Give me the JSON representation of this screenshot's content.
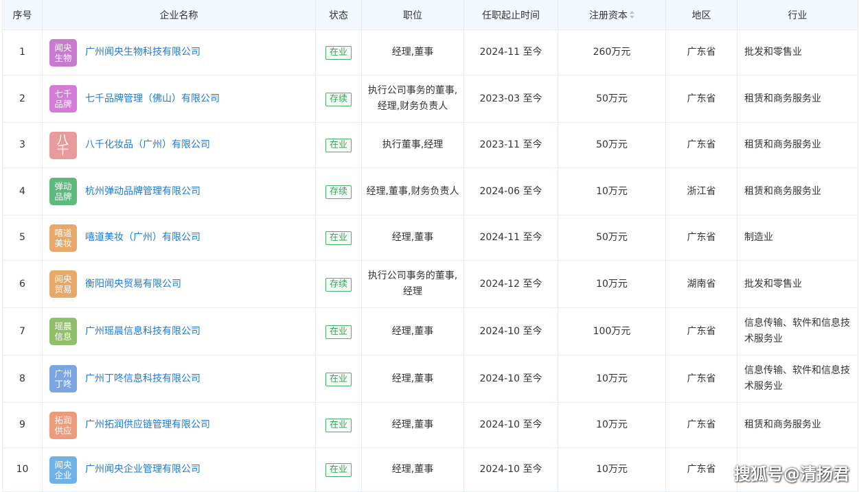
{
  "headers": {
    "index": "序号",
    "name": "企业名称",
    "status": "状态",
    "position": "职位",
    "term": "任职起止时间",
    "capital": "注册资本",
    "region": "地区",
    "industry": "行业"
  },
  "rows": [
    {
      "index": "1",
      "logo": "闻央生物",
      "logo_color": "#c77ad0",
      "name": "广州闻央生物科技有限公司",
      "status": "在业",
      "position": "经理,董事",
      "term": "2024-11 至今",
      "capital": "260万元",
      "region": "广东省",
      "industry": "批发和零售业"
    },
    {
      "index": "2",
      "logo": "七千品牌",
      "logo_color": "#d47bd6",
      "name": "七千品牌管理（佛山）有限公司",
      "status": "存续",
      "position": "执行公司事务的董事,经理,财务负责人",
      "term": "2023-03 至今",
      "capital": "50万元",
      "region": "广东省",
      "industry": "租赁和商务服务业"
    },
    {
      "index": "3",
      "logo": "八千",
      "logo_color": "#e79b9b",
      "name": "八千化妆品（广州）有限公司",
      "status": "在业",
      "position": "执行董事,经理",
      "term": "2023-11 至今",
      "capital": "50万元",
      "region": "广东省",
      "industry": "租赁和商务服务业"
    },
    {
      "index": "4",
      "logo": "弹动品牌",
      "logo_color": "#5dba7c",
      "name": "杭州弹动品牌管理有限公司",
      "status": "存续",
      "position": "经理,董事,财务负责人",
      "term": "2024-06 至今",
      "capital": "10万元",
      "region": "浙江省",
      "industry": "租赁和商务服务业"
    },
    {
      "index": "5",
      "logo": "嘻道美妆",
      "logo_color": "#e8a86a",
      "name": "嘻道美妆（广州）有限公司",
      "status": "在业",
      "position": "经理,董事",
      "term": "2024-11 至今",
      "capital": "50万元",
      "region": "广东省",
      "industry": "制造业"
    },
    {
      "index": "6",
      "logo": "闻央贸易",
      "logo_color": "#e8a86a",
      "name": "衡阳闻央贸易有限公司",
      "status": "存续",
      "position": "执行公司事务的董事,经理",
      "term": "2024-12 至今",
      "capital": "10万元",
      "region": "湖南省",
      "industry": "批发和零售业"
    },
    {
      "index": "7",
      "logo": "瑶晨信息",
      "logo_color": "#8fbf6b",
      "name": "广州瑶晨信息科技有限公司",
      "status": "在业",
      "position": "经理,董事",
      "term": "2024-10 至今",
      "capital": "100万元",
      "region": "广东省",
      "industry": "信息传输、软件和信息技术服务业"
    },
    {
      "index": "8",
      "logo": "广州丁咚",
      "logo_color": "#7aa4e2",
      "name": "广州丁咚信息科技有限公司",
      "status": "在业",
      "position": "经理,董事",
      "term": "2024-10 至今",
      "capital": "10万元",
      "region": "广东省",
      "industry": "信息传输、软件和信息技术服务业"
    },
    {
      "index": "9",
      "logo": "拓润供应",
      "logo_color": "#ec9c7a",
      "name": "广州拓润供应链管理有限公司",
      "status": "在业",
      "position": "经理,董事",
      "term": "2024-10 至今",
      "capital": "10万元",
      "region": "广东省",
      "industry": "租赁和商务服务业"
    },
    {
      "index": "10",
      "logo": "闻央企业",
      "logo_color": "#6fb2e8",
      "name": "广州闻央企业管理有限公司",
      "status": "在业",
      "position": "经理,董事",
      "term": "2024-10 至今",
      "capital": "10万元",
      "region": "广东省",
      "industry": ""
    }
  ],
  "watermark": "搜狐号@清扬君"
}
